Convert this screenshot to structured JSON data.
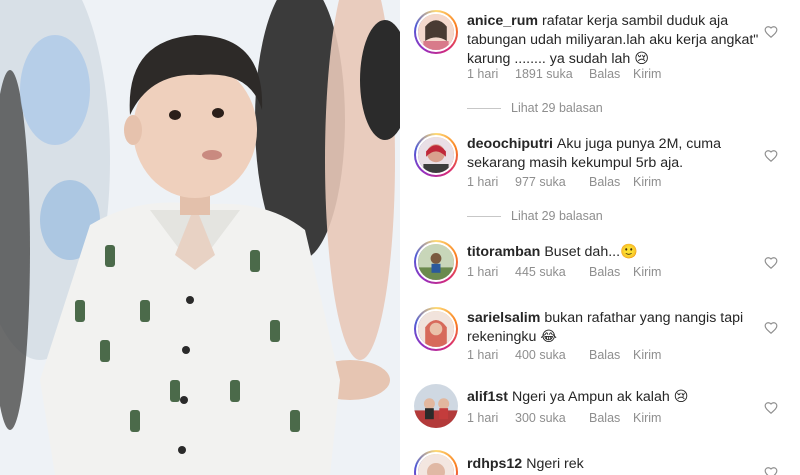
{
  "photo": {
    "alt_icon": "child-photo"
  },
  "comments": [
    {
      "username": "anice_rum",
      "text": "rafatar kerja sambil duduk aja tabungan udah miliyaran.lah aku kerja angkat\" karung ........ ya sudah lah 😢",
      "time": "1 hari",
      "likes": "1891 suka",
      "reply": "Balas",
      "send": "Kirim",
      "replies": "Lihat 29 balasan",
      "ring": true
    },
    {
      "username": "deoochiputri",
      "text": "Aku juga punya 2M, cuma sekarang masih kekumpul 5rb aja.",
      "time": "1 hari",
      "likes": "977 suka",
      "reply": "Balas",
      "send": "Kirim",
      "replies": "Lihat 29 balasan",
      "ring": true
    },
    {
      "username": "titoramban",
      "text": "Buset dah...🙂",
      "time": "1 hari",
      "likes": "445 suka",
      "reply": "Balas",
      "send": "Kirim",
      "ring": true
    },
    {
      "username": "sarielsalim",
      "text": "bukan rafathar yang nangis tapi rekeningku 😂",
      "time": "1 hari",
      "likes": "400 suka",
      "reply": "Balas",
      "send": "Kirim",
      "ring": true
    },
    {
      "username": "alif1st",
      "text": "Ngeri ya Ampun ak kalah 😢",
      "time": "1 hari",
      "likes": "300 suka",
      "reply": "Balas",
      "send": "Kirim",
      "ring": false
    },
    {
      "username": "rdhps12",
      "text": "Ngeri rek",
      "ring": true
    }
  ],
  "colors": {
    "text": "#262626",
    "muted": "#8e8e8e",
    "ring_start": "#feda75",
    "ring_end": "#d62976"
  }
}
